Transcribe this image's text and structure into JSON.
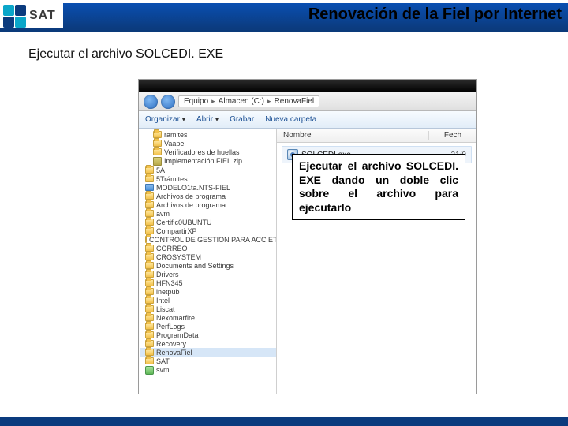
{
  "header": {
    "logo_text": "SAT",
    "title": "Renovación de la Fiel por Internet"
  },
  "subtitle": "Ejecutar el archivo SOLCEDI. EXE",
  "explorer": {
    "breadcrumb": [
      "Equipo",
      "Almacen (C:)",
      "RenovaFiel"
    ],
    "toolbar": {
      "organize": "Organizar",
      "open": "Abrir",
      "burn": "Grabar",
      "newfolder": "Nueva carpeta"
    },
    "columns": {
      "name": "Nombre",
      "date": "Fech"
    },
    "tree": [
      {
        "label": "ramites",
        "icon": "folder",
        "indent": 1
      },
      {
        "label": "Vaapel",
        "icon": "folder",
        "indent": 1
      },
      {
        "label": "Verificadores de huellas",
        "icon": "folder",
        "indent": 1
      },
      {
        "label": "Implementación FIEL.zip",
        "icon": "zip",
        "indent": 1
      },
      {
        "label": "5A",
        "icon": "folder",
        "indent": 0
      },
      {
        "label": "5Trámites",
        "icon": "folder",
        "indent": 0
      },
      {
        "label": "MODELO1ta.NTS-FIEL",
        "icon": "blueimg",
        "indent": 0
      },
      {
        "label": "Archivos de programa",
        "icon": "folder",
        "indent": 0
      },
      {
        "label": "Archivos de programa",
        "icon": "folder",
        "indent": 0
      },
      {
        "label": "avm",
        "icon": "folder",
        "indent": 0
      },
      {
        "label": "Certific0UBUNTU",
        "icon": "folder",
        "indent": 0
      },
      {
        "label": "CompartirXP",
        "icon": "folder",
        "indent": 0
      },
      {
        "label": "CONTROL DE GESTION PARA ACC ET",
        "icon": "folder",
        "indent": 0
      },
      {
        "label": "CORREO",
        "icon": "folder",
        "indent": 0
      },
      {
        "label": "CROSYSTEM",
        "icon": "folder",
        "indent": 0
      },
      {
        "label": "Documents and Settings",
        "icon": "folder",
        "indent": 0
      },
      {
        "label": "Drivers",
        "icon": "folder",
        "indent": 0
      },
      {
        "label": "HFN345",
        "icon": "folder",
        "indent": 0
      },
      {
        "label": "inetpub",
        "icon": "folder",
        "indent": 0
      },
      {
        "label": "Intel",
        "icon": "folder",
        "indent": 0
      },
      {
        "label": "Liscat",
        "icon": "folder",
        "indent": 0
      },
      {
        "label": "Nexomarfire",
        "icon": "folder",
        "indent": 0
      },
      {
        "label": "PerfLogs",
        "icon": "folder",
        "indent": 0
      },
      {
        "label": "ProgramData",
        "icon": "folder",
        "indent": 0
      },
      {
        "label": "Recovery",
        "icon": "folder",
        "indent": 0
      },
      {
        "label": "RenovaFiel",
        "icon": "folder",
        "indent": 0,
        "highlight": true
      },
      {
        "label": "SAT",
        "icon": "folder",
        "indent": 0
      },
      {
        "label": "svm",
        "icon": "greenico",
        "indent": 0
      }
    ],
    "file": {
      "name": "SOLCEDI.exe",
      "date": "21/0"
    }
  },
  "callout": "Ejecutar el archivo SOLCEDI. EXE dando un doble clic sobre el archivo para ejecutarlo"
}
